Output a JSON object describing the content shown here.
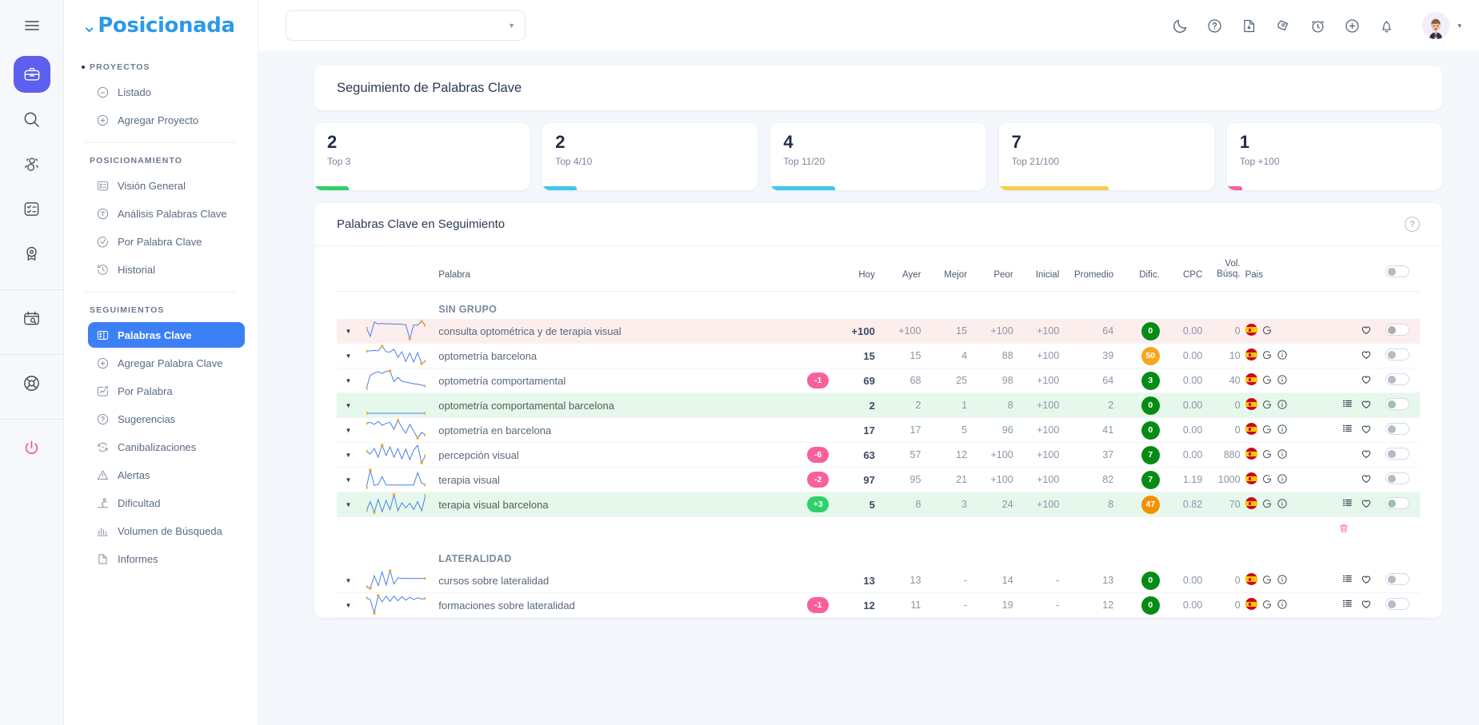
{
  "brand": {
    "name": "Posicionada"
  },
  "rail": {
    "items": [
      {
        "name": "menu-icon",
        "label": "Menú"
      },
      {
        "name": "briefcase-icon",
        "label": "Proyectos",
        "active": true
      },
      {
        "name": "search-icon",
        "label": "Buscar"
      },
      {
        "name": "users-icon",
        "label": "Competencia"
      },
      {
        "name": "checklist-icon",
        "label": "Tareas"
      },
      {
        "name": "badge-icon",
        "label": "Logros"
      },
      {
        "name": "calendar-search-icon",
        "label": "Auditoría"
      },
      {
        "name": "lifebuoy-icon",
        "label": "Soporte"
      },
      {
        "name": "power-icon",
        "label": "Salir"
      }
    ]
  },
  "sidebar": {
    "sections": [
      {
        "label": "PROYECTOS",
        "bullet": true,
        "items": [
          {
            "label": "Listado",
            "icon": "minus-circle-icon",
            "active": false
          },
          {
            "label": "Agregar Proyecto",
            "icon": "plus-circle-icon",
            "active": false
          }
        ]
      },
      {
        "label": "POSICIONAMIENTO",
        "bullet": false,
        "items": [
          {
            "label": "Visión General",
            "icon": "dashboard-icon",
            "active": false
          },
          {
            "label": "Análisis Palabras Clave",
            "icon": "text-circle-icon",
            "active": false
          },
          {
            "label": "Por Palabra Clave",
            "icon": "target-circle-icon",
            "active": false
          },
          {
            "label": "Historial",
            "icon": "history-icon",
            "active": false
          }
        ]
      },
      {
        "label": "SEGUIMIENTOS",
        "bullet": false,
        "items": [
          {
            "label": "Palabras Clave",
            "icon": "keyword-panel-icon",
            "active": true
          },
          {
            "label": "Agregar Palabra Clave",
            "icon": "plus-circle-icon",
            "active": false
          },
          {
            "label": "Por Palabra",
            "icon": "trend-box-icon",
            "active": false
          },
          {
            "label": "Sugerencias",
            "icon": "question-circle-icon",
            "active": false
          },
          {
            "label": "Canibalizaciones",
            "icon": "refresh-circle-icon",
            "active": false
          },
          {
            "label": "Alertas",
            "icon": "warning-triangle-icon",
            "active": false
          },
          {
            "label": "Dificultad",
            "icon": "difficulty-icon",
            "active": false
          },
          {
            "label": "Volumen de Búsqueda",
            "icon": "bar-chart-icon",
            "active": false
          },
          {
            "label": "Informes",
            "icon": "document-icon",
            "active": false
          }
        ]
      }
    ]
  },
  "topbar": {
    "project_select": {
      "value": "",
      "placeholder": ""
    },
    "icons": [
      {
        "name": "moon-icon",
        "label": "Modo oscuro"
      },
      {
        "name": "question-circle-icon",
        "label": "Ayuda"
      },
      {
        "name": "file-download-icon",
        "label": "Descargar"
      },
      {
        "name": "chat-stack-icon",
        "label": "Mensajes"
      },
      {
        "name": "alarm-clock-icon",
        "label": "Recordatorios"
      },
      {
        "name": "plus-circle-icon",
        "label": "Agregar"
      },
      {
        "name": "bell-icon",
        "label": "Notificaciones"
      }
    ],
    "avatar": {
      "name": "avatar",
      "caret": "▾"
    }
  },
  "page": {
    "title": "Seguimiento de Palabras Clave"
  },
  "stats": [
    {
      "value": "2",
      "label": "Top 3",
      "color": "#2fcf6a",
      "width_pct": 16
    },
    {
      "value": "2",
      "label": "Top 4/10",
      "color": "#3ec7e8",
      "width_pct": 16
    },
    {
      "value": "4",
      "label": "Top 11/20",
      "color": "#3ec7e8",
      "width_pct": 30
    },
    {
      "value": "7",
      "label": "Top 21/100",
      "color": "#f7ce4b",
      "width_pct": 51
    },
    {
      "value": "1",
      "label": "Top +100",
      "color": "#f8609c",
      "width_pct": 7
    }
  ],
  "table": {
    "title": "Palabras Clave en Seguimiento",
    "help_icon": "?",
    "columns": {
      "palabra": "Palabra",
      "hoy": "Hoy",
      "ayer": "Ayer",
      "mejor": "Mejor",
      "peor": "Peor",
      "inicial": "Inicial",
      "promedio": "Promedio",
      "dific": "Dific.",
      "cpc": "CPC",
      "vol_line1": "Vol.",
      "vol_line2": "Búsq.",
      "pais": "Pais"
    },
    "groups": [
      {
        "name": "SIN GRUPO",
        "has_trash": true,
        "rows": [
          {
            "word": "consulta optométrica y de terapia visual",
            "delta": "",
            "delta_dir": "",
            "hoy": "+100",
            "ayer": "+100",
            "mejor": "15",
            "peor": "+100",
            "inicial": "+100",
            "promedio": "64",
            "dific": "0",
            "dific_color": "green",
            "cpc": "0.00",
            "vol": "0",
            "flag": "es",
            "has_google": true,
            "has_info": false,
            "has_list": false,
            "has_heart": true,
            "toggle_on": false,
            "highlight": "neg",
            "spark": [
              62,
              30,
              85,
              78,
              80,
              78,
              79,
              77,
              78,
              76,
              75,
              20,
              74,
              73,
              88,
              72
            ]
          },
          {
            "word": "optometría barcelona",
            "delta": "",
            "delta_dir": "",
            "hoy": "15",
            "ayer": "15",
            "mejor": "4",
            "peor": "88",
            "inicial": "+100",
            "promedio": "39",
            "dific": "50",
            "dific_color": "orange",
            "cpc": "0.00",
            "vol": "10",
            "flag": "es",
            "has_google": true,
            "has_info": true,
            "has_list": false,
            "has_heart": true,
            "toggle_on": false,
            "highlight": "",
            "spark": [
              68,
              70,
              72,
              70,
              92,
              66,
              64,
              78,
              40,
              66,
              20,
              60,
              18,
              62,
              10,
              22
            ]
          },
          {
            "word": "optometría comportamental",
            "delta": "-1",
            "delta_dir": "down",
            "hoy": "69",
            "ayer": "68",
            "mejor": "25",
            "peor": "98",
            "inicial": "+100",
            "promedio": "64",
            "dific": "3",
            "dific_color": "green",
            "cpc": "0.00",
            "vol": "40",
            "flag": "es",
            "has_google": true,
            "has_info": true,
            "has_list": false,
            "has_heart": true,
            "toggle_on": false,
            "highlight": "",
            "spark": [
              8,
              70,
              80,
              86,
              78,
              88,
              90,
              40,
              60,
              42,
              38,
              34,
              30,
              28,
              24,
              20
            ]
          },
          {
            "word": "optometría comportamental barcelona",
            "delta": "",
            "delta_dir": "",
            "hoy": "2",
            "ayer": "2",
            "mejor": "1",
            "peor": "8",
            "inicial": "+100",
            "promedio": "2",
            "dific": "0",
            "dific_color": "green",
            "cpc": "0.00",
            "vol": "0",
            "flag": "es",
            "has_google": true,
            "has_info": true,
            "has_list": true,
            "has_heart": true,
            "toggle_on": false,
            "highlight": "pos",
            "spark": [
              50,
              50,
              50,
              50,
              50,
              50,
              50,
              50,
              50,
              50,
              50,
              50,
              50,
              50,
              50,
              50
            ]
          },
          {
            "word": "optometría en barcelona",
            "delta": "",
            "delta_dir": "",
            "hoy": "17",
            "ayer": "17",
            "mejor": "5",
            "peor": "96",
            "inicial": "+100",
            "promedio": "41",
            "dific": "0",
            "dific_color": "green",
            "cpc": "0.00",
            "vol": "0",
            "flag": "es",
            "has_google": true,
            "has_info": true,
            "has_list": true,
            "has_heart": true,
            "toggle_on": false,
            "highlight": "",
            "spark": [
              60,
              62,
              58,
              64,
              56,
              60,
              62,
              48,
              66,
              52,
              40,
              58,
              44,
              30,
              42,
              36
            ]
          },
          {
            "word": "percepción visual",
            "delta": "-6",
            "delta_dir": "down",
            "hoy": "63",
            "ayer": "57",
            "mejor": "12",
            "peor": "+100",
            "inicial": "+100",
            "promedio": "37",
            "dific": "7",
            "dific_color": "green",
            "cpc": "0.00",
            "vol": "880",
            "flag": "es",
            "has_google": true,
            "has_info": true,
            "has_list": false,
            "has_heart": true,
            "toggle_on": false,
            "highlight": "",
            "spark": [
              55,
              48,
              62,
              40,
              70,
              44,
              66,
              40,
              62,
              36,
              60,
              34,
              58,
              70,
              26,
              44
            ]
          },
          {
            "word": "terapia visual",
            "delta": "-2",
            "delta_dir": "down",
            "hoy": "97",
            "ayer": "95",
            "mejor": "21",
            "peor": "+100",
            "inicial": "+100",
            "promedio": "82",
            "dific": "7",
            "dific_color": "green",
            "cpc": "1.19",
            "vol": "1000",
            "flag": "es",
            "has_google": true,
            "has_info": true,
            "has_list": false,
            "has_heart": true,
            "toggle_on": false,
            "highlight": "",
            "spark": [
              10,
              90,
              20,
              24,
              60,
              22,
              22,
              22,
              22,
              22,
              22,
              22,
              22,
              78,
              30,
              22
            ]
          },
          {
            "word": "terapia visual barcelona",
            "delta": "+3",
            "delta_dir": "up",
            "hoy": "5",
            "ayer": "8",
            "mejor": "3",
            "peor": "24",
            "inicial": "+100",
            "promedio": "8",
            "dific": "47",
            "dific_color": "amber",
            "cpc": "0.82",
            "vol": "70",
            "flag": "es",
            "has_google": true,
            "has_info": true,
            "has_list": true,
            "has_heart": true,
            "toggle_on": false,
            "highlight": "pos",
            "spark": [
              30,
              62,
              24,
              70,
              26,
              66,
              34,
              86,
              30,
              58,
              40,
              56,
              34,
              62,
              30,
              84
            ]
          }
        ]
      },
      {
        "name": "LATERALIDAD",
        "has_trash": false,
        "rows": [
          {
            "word": "cursos sobre lateralidad",
            "delta": "",
            "delta_dir": "",
            "hoy": "13",
            "ayer": "13",
            "mejor": "-",
            "peor": "14",
            "inicial": "-",
            "promedio": "13",
            "dific": "0",
            "dific_color": "green",
            "cpc": "0.00",
            "vol": "0",
            "flag": "es",
            "has_google": true,
            "has_info": true,
            "has_list": true,
            "has_heart": true,
            "toggle_on": false,
            "highlight": "",
            "spark": [
              30,
              24,
              70,
              34,
              84,
              36,
              88,
              40,
              62,
              60,
              60,
              60,
              60,
              60,
              60,
              60
            ]
          },
          {
            "word": "formaciones sobre lateralidad",
            "delta": "-1",
            "delta_dir": "down",
            "hoy": "12",
            "ayer": "11",
            "mejor": "-",
            "peor": "19",
            "inicial": "-",
            "promedio": "12",
            "dific": "0",
            "dific_color": "green",
            "cpc": "0.00",
            "vol": "0",
            "flag": "es",
            "has_google": true,
            "has_info": true,
            "has_list": true,
            "has_heart": true,
            "toggle_on": false,
            "highlight": "",
            "spark": [
              72,
              66,
              20,
              80,
              58,
              78,
              60,
              78,
              62,
              76,
              64,
              74,
              66,
              72,
              68,
              70
            ]
          }
        ]
      }
    ]
  }
}
